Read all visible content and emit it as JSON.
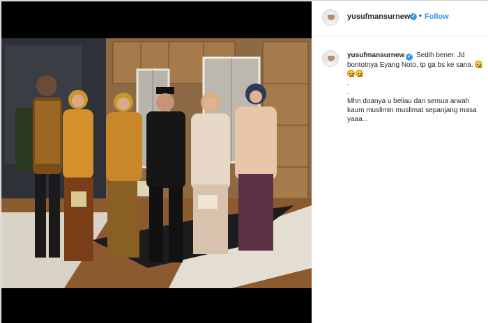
{
  "post": {
    "username": "yusufmansurnew",
    "follow_label": "Follow",
    "separator": "•"
  },
  "comment": {
    "username": "yusufmansurnew",
    "line1": "Sedih bener. Jd bontotnya Eyang Noto, tp ga bs ke sana.",
    "emoji_count": 3,
    "dot1": ".",
    "dot2": ".",
    "line2": "Mhn doanya u beliau dan semua arwah kaum muslimin muslimat sepanjang masa yaaa..."
  },
  "colors": {
    "accent": "#3897f0",
    "photo_bg": "#000000"
  }
}
